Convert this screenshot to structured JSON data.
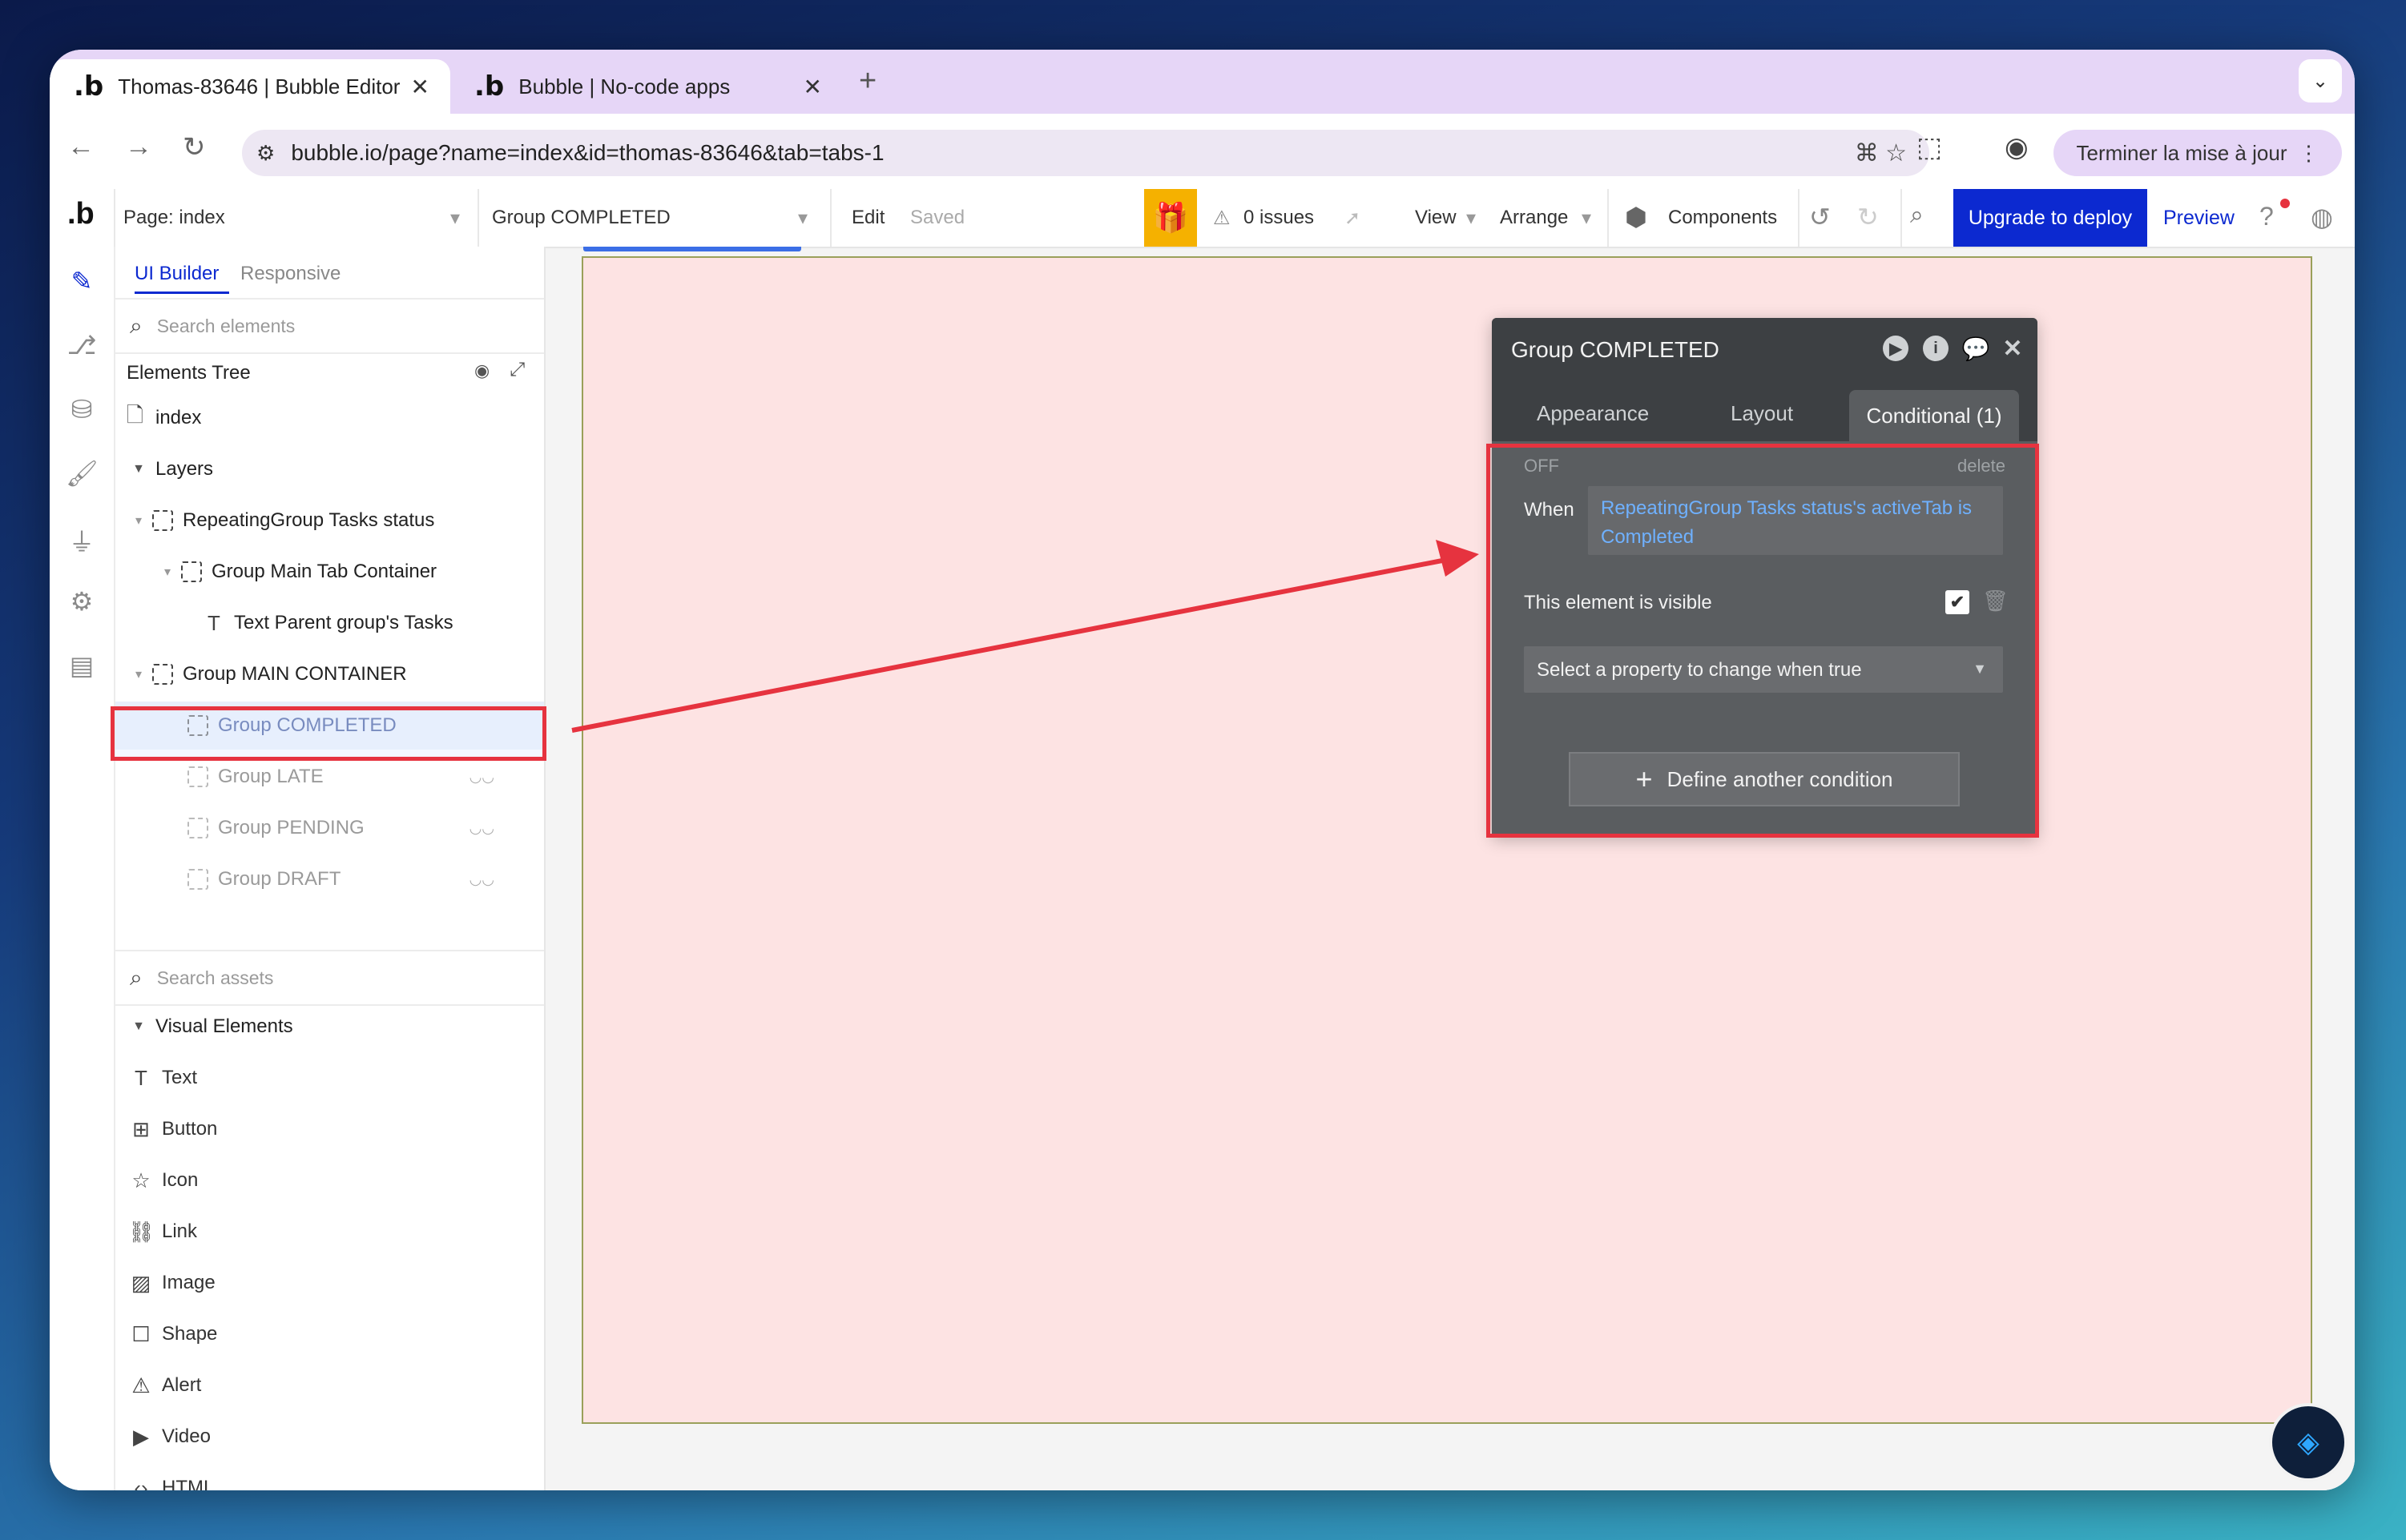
{
  "browser": {
    "tabs": [
      {
        "favicon": ".b",
        "title": "Thomas-83646 | Bubble Editor",
        "close": "✕"
      },
      {
        "favicon": ".b",
        "title": "Bubble | No-code apps",
        "close": "✕"
      }
    ],
    "new_tab": "+",
    "url": "bubble.io/page?name=index&id=thomas-83646&tab=tabs-1",
    "update_button": "Terminer la mise à jour"
  },
  "appbar": {
    "logo": ".b",
    "page_label": "Page: index",
    "element_label": "Group COMPLETED",
    "edit": "Edit",
    "saved": "Saved",
    "issues": "0 issues",
    "view": "View",
    "arrange": "Arrange",
    "components": "Components",
    "upgrade": "Upgrade to deploy",
    "preview": "Preview"
  },
  "left_panel": {
    "tab_ui_builder": "UI Builder",
    "tab_responsive": "Responsive",
    "search_elements_placeholder": "Search elements",
    "elements_tree_title": "Elements Tree",
    "index_label": "index",
    "layers_label": "Layers",
    "tree": [
      {
        "label": "RepeatingGroup Tasks status"
      },
      {
        "label": "Group Main Tab Container"
      },
      {
        "label": "Text Parent group's Tasks"
      },
      {
        "label": "Group MAIN CONTAINER"
      },
      {
        "label": "Group COMPLETED"
      },
      {
        "label": "Group LATE"
      },
      {
        "label": "Group PENDING"
      },
      {
        "label": "Group DRAFT"
      }
    ],
    "search_assets_placeholder": "Search assets",
    "visual_elements_title": "Visual Elements",
    "visual_elements": [
      "Text",
      "Button",
      "Icon",
      "Link",
      "Image",
      "Shape",
      "Alert",
      "Video",
      "HTML"
    ]
  },
  "editor": {
    "title": "Group COMPLETED",
    "tabs": [
      "Appearance",
      "Layout",
      "Conditional (1)"
    ],
    "off": "OFF",
    "delete": "delete",
    "when": "When",
    "condition": "RepeatingGroup Tasks status's activeTab is Completed",
    "visible_label": "This element is visible",
    "property_select": "Select a property to change when true",
    "define_button": "Define another condition"
  },
  "colors": {
    "accent": "#0c29d0",
    "highlight_red": "#e6333f",
    "canvas_pink": "#fde3e3",
    "gift_orange": "#f5b100"
  }
}
